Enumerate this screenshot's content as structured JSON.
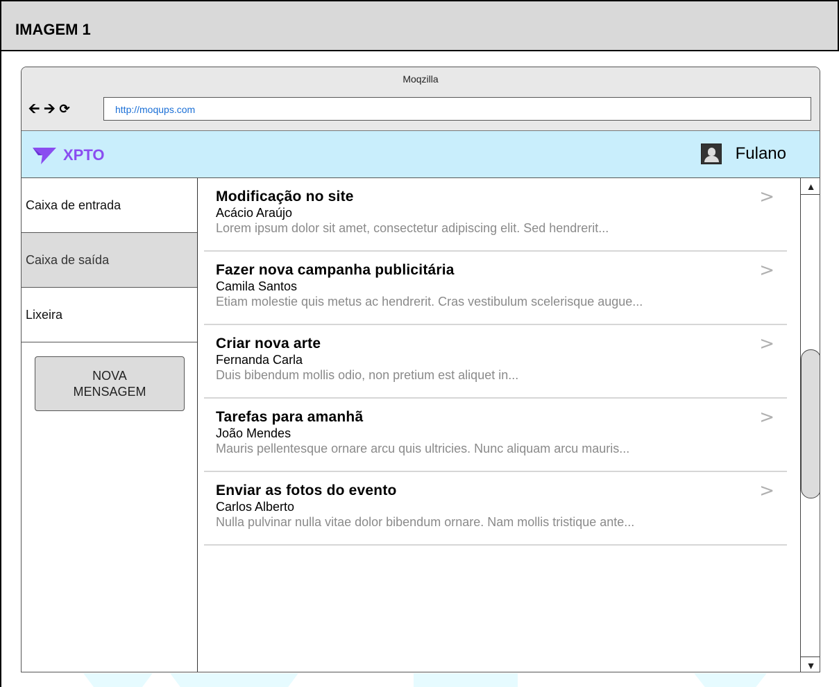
{
  "page": {
    "heading": "IMAGEM 1"
  },
  "browser": {
    "window_title": "Moqzilla",
    "url": "http://moqups.com",
    "nav": {
      "back_icon": "arrow-left-icon",
      "forward_icon": "arrow-right-icon",
      "reload_icon": "reload-icon"
    }
  },
  "app": {
    "brand": "XPTO",
    "brand_color": "#8a4df0",
    "header_color": "#c9eefc",
    "user_name": "Fulano"
  },
  "sidebar": {
    "items": [
      {
        "label": "Caixa de entrada",
        "active": false
      },
      {
        "label": "Caixa de saída",
        "active": true
      },
      {
        "label": "Lixeira",
        "active": false
      }
    ],
    "new_message_label": "NOVA\nMENSAGEM"
  },
  "messages": [
    {
      "subject": "Modificação no site",
      "from": "Acácio Araújo",
      "preview": "Lorem ipsum dolor sit amet, consectetur adipiscing elit. Sed hendrerit..."
    },
    {
      "subject": "Fazer nova campanha publicitária",
      "from": "Camila Santos",
      "preview": "Etiam molestie quis metus ac hendrerit. Cras vestibulum scelerisque augue..."
    },
    {
      "subject": "Criar nova arte",
      "from": "Fernanda Carla",
      "preview": "Duis bibendum mollis odio, non pretium est aliquet in..."
    },
    {
      "subject": "Tarefas para amanhã",
      "from": "João Mendes",
      "preview": "Mauris pellentesque ornare arcu quis ultricies. Nunc aliquam arcu mauris..."
    },
    {
      "subject": "Enviar as fotos do evento",
      "from": "Carlos Alberto",
      "preview": "Nulla pulvinar nulla vitae dolor bibendum ornare. Nam mollis tristique ante..."
    }
  ],
  "icons": {
    "chevron": ">",
    "scroll_up": "▲",
    "scroll_down": "▼"
  }
}
